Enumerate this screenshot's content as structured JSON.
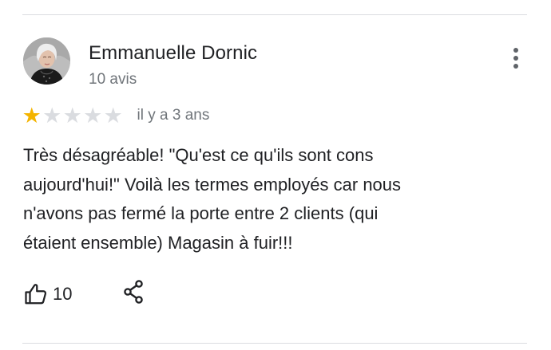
{
  "review": {
    "author": {
      "name": "Emmanuelle Dornic",
      "review_count": "10 avis"
    },
    "rating": {
      "value": 1,
      "max": 5,
      "filled_color": "#f4b400",
      "empty_color": "#dadce0"
    },
    "date": "il y a 3 ans",
    "text": "Très désagréable! \"Qu'est ce qu'ils sont cons\naujourd'hui!\" Voilà les termes employés car nous\nn'avons pas fermé la porte entre 2 clients  (qui\nétaient ensemble) Magasin à fuir!!!",
    "actions": {
      "like_count": "10",
      "like_icon": "thumbs-up-icon",
      "share_icon": "share-icon",
      "more_icon": "more-vert-icon"
    }
  }
}
